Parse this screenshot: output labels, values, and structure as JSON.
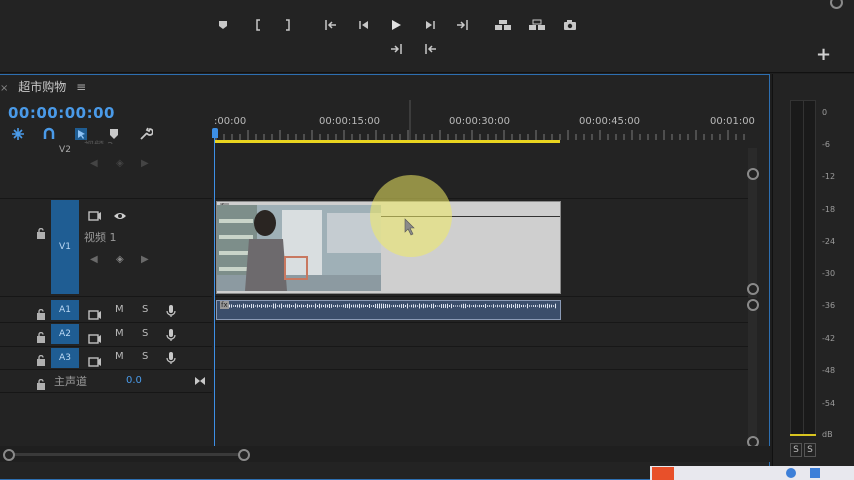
{
  "sequence": {
    "tab_title": "超市购物",
    "menu_glyph": "≡",
    "close_glyph": "×",
    "timecode": "00:00:00:00"
  },
  "ruler": {
    "labels": [
      ":00:00",
      "00:00:15:00",
      "00:00:30:00",
      "00:00:45:00",
      "00:01:00"
    ]
  },
  "tracks": {
    "v2": {
      "label": "V2",
      "name": "视频 2"
    },
    "v1": {
      "label": "V1",
      "name": "视频 1"
    },
    "a1": {
      "label": "A1"
    },
    "a2": {
      "label": "A2"
    },
    "a3": {
      "label": "A3"
    },
    "master": {
      "name": "主声道",
      "value": "0.0"
    },
    "mute_label": "M",
    "solo_label": "S",
    "fx_badge": "fx"
  },
  "meter": {
    "db_labels": [
      "0",
      "-6",
      "-12",
      "-18",
      "-24",
      "-30",
      "-36",
      "-42",
      "-48",
      "-54",
      "dB"
    ],
    "solo_left": "S",
    "solo_right": "S"
  },
  "icons": {
    "transport": [
      "marker-icon",
      "mark-in-icon",
      "mark-out-icon",
      "go-to-in-icon",
      "step-back-icon",
      "play-icon",
      "step-forward-icon",
      "go-to-out-icon",
      "lift-icon",
      "extract-icon",
      "export-frame-icon",
      "insert-icon",
      "overwrite-icon"
    ],
    "tools": [
      "snap-icon",
      "linked-selection-icon",
      "select-icon",
      "add-marker-icon",
      "wrench-icon"
    ]
  },
  "colors": {
    "accent": "#4a9ae8",
    "track_blue": "#1f5d93",
    "work_area": "#e9d41f"
  }
}
